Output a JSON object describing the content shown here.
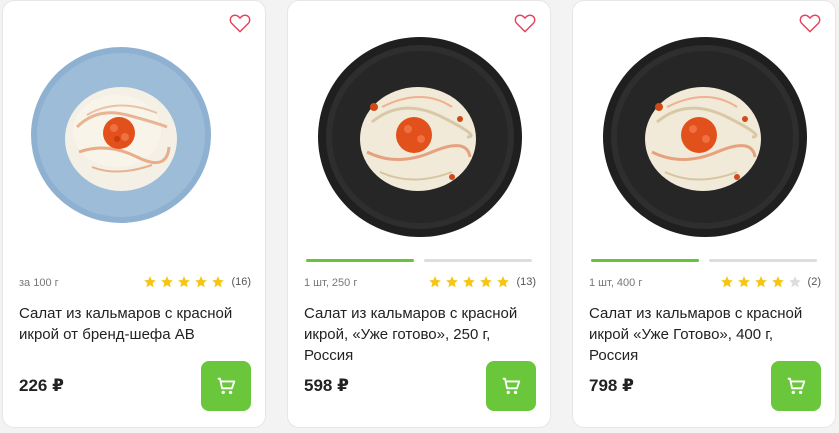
{
  "colors": {
    "accent": "#6ac63b",
    "star": "#f5c518",
    "star_empty": "#dddddd",
    "heart": "#e8425a"
  },
  "products": [
    {
      "weight": "за 100 г",
      "rating_stars": 5,
      "rating_max": 5,
      "reviews": "(16)",
      "title": "Салат из кальмаров с красной икрой от бренд-шефа АВ",
      "price": "226 ₽",
      "image_icon": "salad-blue-plate-image",
      "gallery_pages": 0,
      "gallery_active": 0
    },
    {
      "weight": "1 шт, 250 г",
      "rating_stars": 5,
      "rating_max": 5,
      "reviews": "(13)",
      "title": "Салат из кальмаров с красной икрой, «Уже готово», 250 г, Россия",
      "price": "598 ₽",
      "image_icon": "salad-black-plate-image",
      "gallery_pages": 2,
      "gallery_active": 0
    },
    {
      "weight": "1 шт, 400 г",
      "rating_stars": 4,
      "rating_max": 5,
      "reviews": "(2)",
      "title": "Салат из кальмаров с красной икрой «Уже Готово», 400 г, Россия",
      "price": "798 ₽",
      "image_icon": "salad-black-plate-image",
      "gallery_pages": 2,
      "gallery_active": 0
    }
  ]
}
